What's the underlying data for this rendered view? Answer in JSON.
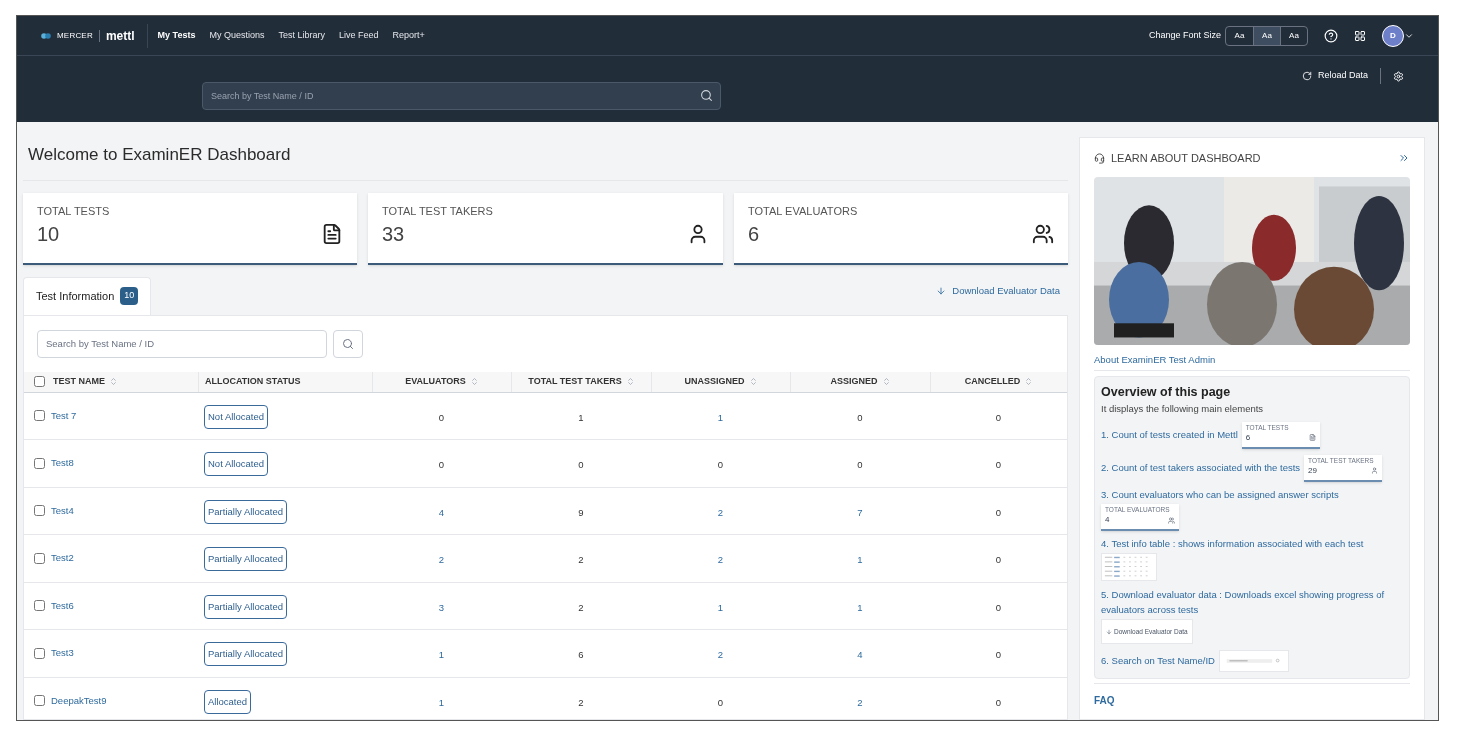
{
  "nav": {
    "brand": "MERCER",
    "product": "mettl",
    "links": [
      {
        "label": "My Tests",
        "selected": true
      },
      {
        "label": "My Questions",
        "selected": false
      },
      {
        "label": "Test Library",
        "selected": false
      },
      {
        "label": "Live Feed",
        "selected": false
      },
      {
        "label": "Report+",
        "selected": false
      }
    ],
    "font_size_label": "Change Font Size",
    "font_sizes": [
      {
        "label": "Aa",
        "selected": false
      },
      {
        "label": "Aa",
        "selected": true
      },
      {
        "label": "Aa",
        "selected": false
      }
    ],
    "avatar": "D"
  },
  "search_band": {
    "placeholder": "Search by Test Name / ID",
    "reload": "Reload Data"
  },
  "title": "Welcome to ExaminER Dashboard",
  "stats": [
    {
      "label": "TOTAL TESTS",
      "value": "10",
      "kind": "document"
    },
    {
      "label": "TOTAL TEST TAKERS",
      "value": "33",
      "kind": "person"
    },
    {
      "label": "TOTAL EVALUATORS",
      "value": "6",
      "kind": "group"
    }
  ],
  "tabs": [
    {
      "label": "Test Information",
      "count": "10",
      "selected": true
    }
  ],
  "download": "Download Evaluator Data",
  "table_search": {
    "placeholder": "Search by Test Name / ID"
  },
  "table": {
    "columns": [
      {
        "label": "TEST NAME",
        "sortable": true
      },
      {
        "label": "ALLOCATION STATUS",
        "sortable": false
      },
      {
        "label": "EVALUATORS",
        "sortable": true
      },
      {
        "label": "TOTAL TEST TAKERS",
        "sortable": true
      },
      {
        "label": "UNASSIGNED",
        "sortable": true
      },
      {
        "label": "ASSIGNED",
        "sortable": true
      },
      {
        "label": "CANCELLED",
        "sortable": true
      }
    ],
    "select_all_checked": false,
    "rows": [
      {
        "checked": false,
        "cells": [
          "Test 7",
          "Not Allocated",
          "0",
          "1",
          "1",
          "0",
          "0"
        ],
        "linked": [
          true,
          false,
          false,
          false,
          true,
          false,
          false
        ]
      },
      {
        "checked": false,
        "cells": [
          "Test8",
          "Not Allocated",
          "0",
          "0",
          "0",
          "0",
          "0"
        ],
        "linked": [
          true,
          false,
          false,
          false,
          false,
          false,
          false
        ]
      },
      {
        "checked": false,
        "cells": [
          "Test4",
          "Partially Allocated",
          "4",
          "9",
          "2",
          "7",
          "0"
        ],
        "linked": [
          true,
          false,
          true,
          false,
          true,
          true,
          false
        ]
      },
      {
        "checked": false,
        "cells": [
          "Test2",
          "Partially Allocated",
          "2",
          "2",
          "2",
          "1",
          "0"
        ],
        "linked": [
          true,
          false,
          true,
          false,
          true,
          true,
          false
        ]
      },
      {
        "checked": false,
        "cells": [
          "Test6",
          "Partially Allocated",
          "3",
          "2",
          "1",
          "1",
          "0"
        ],
        "linked": [
          true,
          false,
          true,
          false,
          true,
          true,
          false
        ]
      },
      {
        "checked": false,
        "cells": [
          "Test3",
          "Partially Allocated",
          "1",
          "6",
          "2",
          "4",
          "0"
        ],
        "linked": [
          true,
          false,
          true,
          false,
          true,
          true,
          false
        ]
      },
      {
        "checked": false,
        "cells": [
          "DeepakTest9",
          "Allocated",
          "1",
          "2",
          "0",
          "2",
          "0"
        ],
        "linked": [
          true,
          false,
          true,
          false,
          false,
          true,
          false
        ]
      }
    ]
  },
  "learn": {
    "title": "LEARN ABOUT DASHBOARD",
    "about_link": "About ExaminER Test Admin",
    "overview": {
      "title": "Overview of this page",
      "subtitle": "It displays the following main elements",
      "items": [
        {
          "text": "1. Count of tests created in Mettl",
          "kind": "stat",
          "thumb_label": "TOTAL TESTS",
          "thumb_value": "6"
        },
        {
          "text": "2. Count of test takers associated with the tests",
          "kind": "stat",
          "thumb_label": "TOTAL TEST TAKERS",
          "thumb_value": "29"
        },
        {
          "text": "3. Count evaluators who can be assigned answer scripts",
          "kind": "stat_below",
          "thumb_label": "TOTAL EVALUATORS",
          "thumb_value": "4"
        },
        {
          "text": "4. Test info table : shows information associated with each test",
          "kind": "table"
        },
        {
          "text": "5. Download evaluator data : Downloads excel showing progress of evaluators across tests",
          "kind": "download",
          "thumb_label": "Download Evaluator Data"
        },
        {
          "text": "6. Search on Test Name/ID",
          "kind": "search"
        }
      ]
    },
    "faq": "FAQ"
  }
}
